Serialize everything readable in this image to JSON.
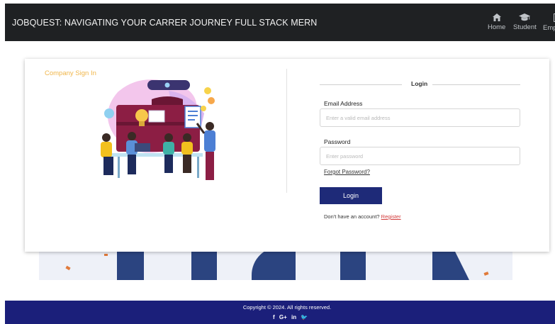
{
  "navbar": {
    "brand": "JOBQUEST: NAVIGATING YOUR CARRER JOURNEY FULL STACK MERN",
    "links": [
      {
        "label": "Home",
        "icon": "home-icon"
      },
      {
        "label": "Student",
        "icon": "graduation-cap-icon"
      },
      {
        "label": "Employer",
        "icon": "id-card-icon"
      }
    ]
  },
  "card": {
    "company_title": "Company Sign In",
    "login": {
      "heading": "Login",
      "email_label": "Email Address",
      "email_placeholder": "Enter a valid email address",
      "password_label": "Password",
      "password_placeholder": "Enter password",
      "forgot": "Forgot Password?",
      "button": "Login",
      "signup_prompt": "Don't have an account?",
      "signup_link": "Register"
    }
  },
  "footer": {
    "copyright": "Copyright © 2024. All rights reserved.",
    "social": [
      "f",
      "G+",
      "in",
      "🐦"
    ]
  },
  "colors": {
    "navbar_bg": "#1f2123",
    "accent_title": "#f0b64a",
    "button_bg": "#1e2a78",
    "footer_bg": "#1b1f7a",
    "link_red": "#d23c3c"
  }
}
